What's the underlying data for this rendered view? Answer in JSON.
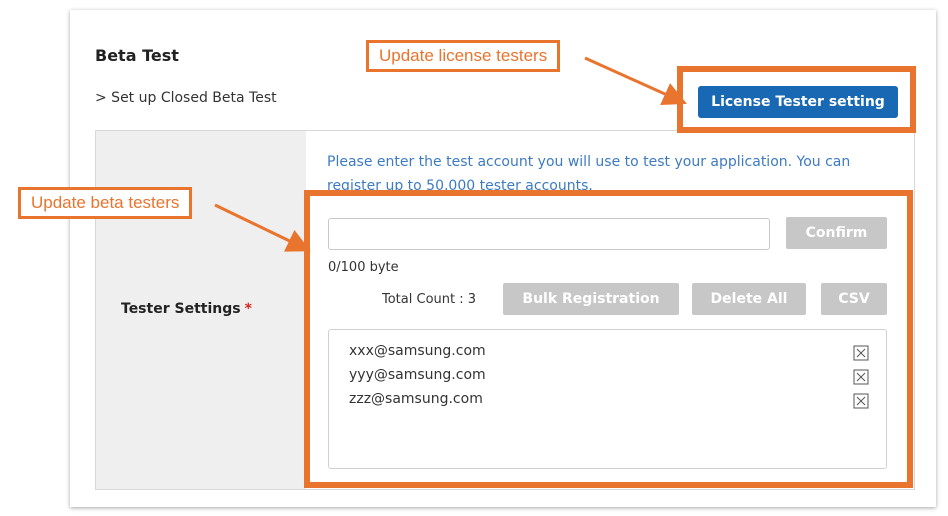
{
  "section": {
    "title": "Beta Test",
    "subtitle": "> Set up Closed Beta Test",
    "license_button_label": "License Tester setting"
  },
  "tester_settings": {
    "label": "Tester Settings",
    "required_marker": "*",
    "info_text": "Please enter the test account you will use to test your application. You can register up to 50,000 tester accounts.",
    "input_value": "",
    "input_placeholder": "",
    "confirm_label": "Confirm",
    "byte_count": "0/100 byte",
    "total_count_label": "Total Count : 3",
    "bulk_registration_label": "Bulk Registration",
    "delete_all_label": "Delete All",
    "csv_label": "CSV",
    "testers": [
      "xxx@samsung.com",
      "yyy@samsung.com",
      "zzz@samsung.com"
    ]
  },
  "annotations": {
    "license_callout": "Update license testers",
    "beta_callout": "Update beta testers",
    "color": "#e8742e"
  },
  "colors": {
    "primary_button": "#1968b3",
    "disabled_button": "#c7c7c7",
    "info_text": "#3d7bc1",
    "required": "#d9261c"
  },
  "icons": {
    "remove": "close-icon"
  }
}
